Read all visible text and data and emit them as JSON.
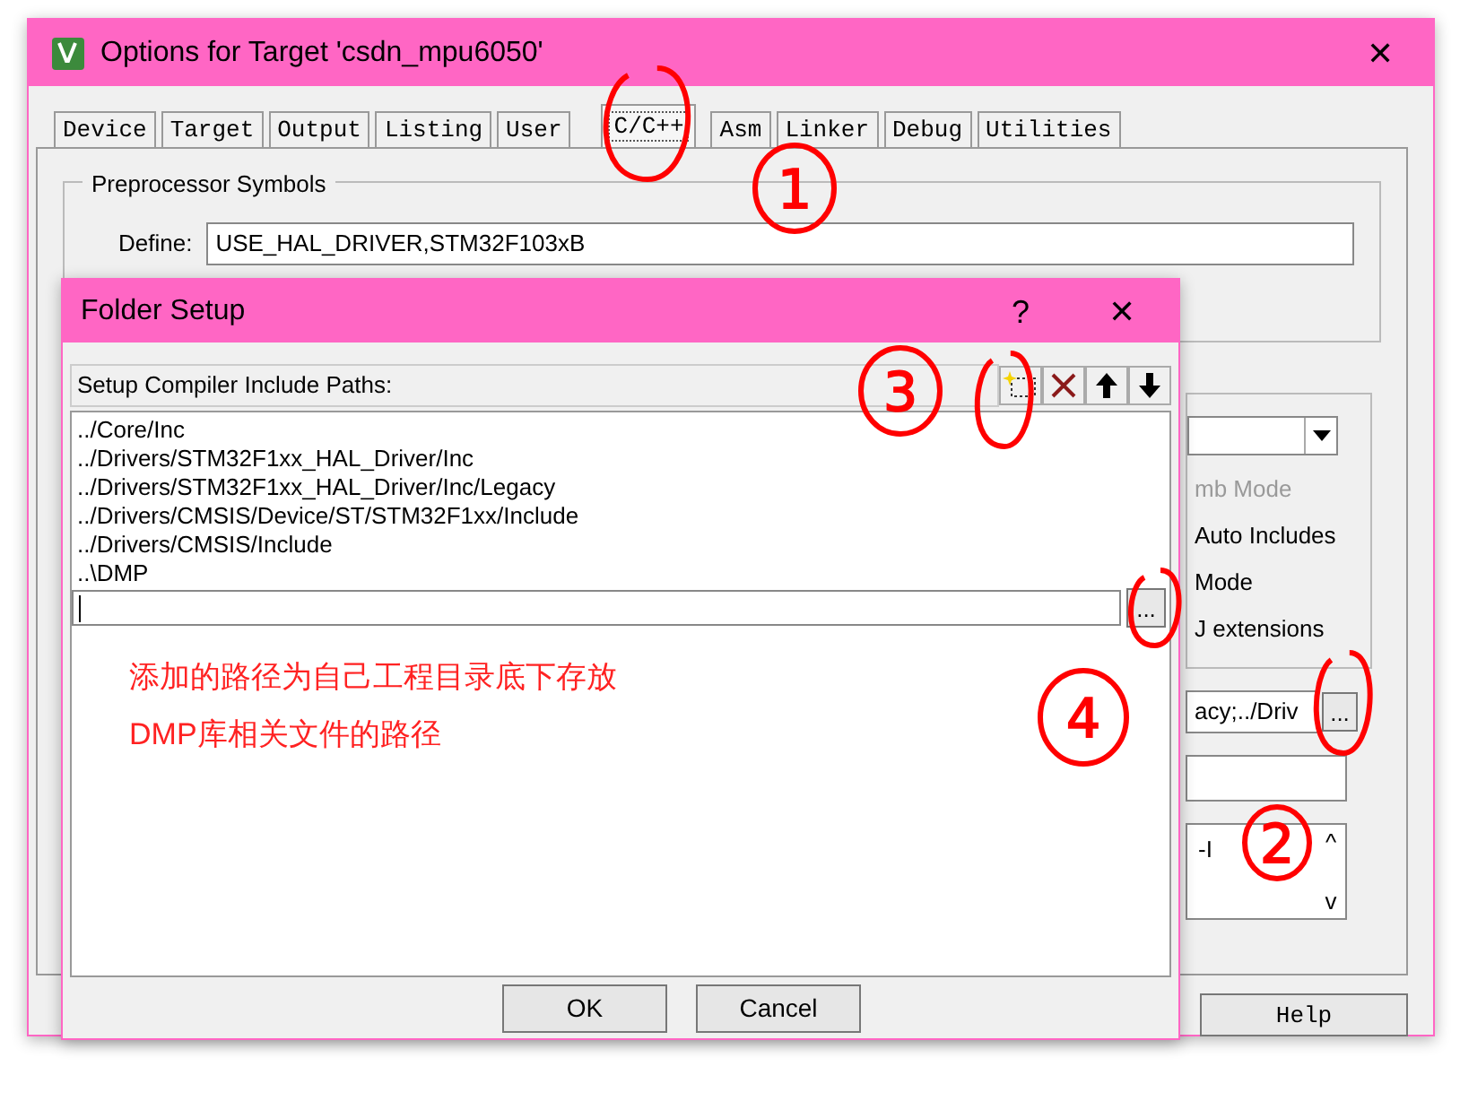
{
  "window": {
    "title": "Options for Target 'csdn_mpu6050'",
    "close": "✕"
  },
  "tabs": [
    {
      "label": "Device",
      "selected": false
    },
    {
      "label": "Target",
      "selected": false
    },
    {
      "label": "Output",
      "selected": false
    },
    {
      "label": "Listing",
      "selected": false
    },
    {
      "label": "User",
      "selected": false
    },
    {
      "label": "C/C++",
      "selected": true
    },
    {
      "label": "Asm",
      "selected": false
    },
    {
      "label": "Linker",
      "selected": false
    },
    {
      "label": "Debug",
      "selected": false
    },
    {
      "label": "Utilities",
      "selected": false
    }
  ],
  "preprocessor": {
    "title": "Preprocessor Symbols",
    "define_label": "Define:",
    "define_value": "USE_HAL_DRIVER,STM32F103xB"
  },
  "options": [
    {
      "label": "mb Mode",
      "disabled": true
    },
    {
      "label": "Auto Includes",
      "disabled": false
    },
    {
      "label": "Mode",
      "disabled": false
    },
    {
      "label": "J extensions",
      "disabled": false
    }
  ],
  "include_paths_field": {
    "value": "acy;../Driv",
    "browse": "..."
  },
  "misc_controls": {
    "value": "-I",
    "scroll_up": "^",
    "scroll_down": "v"
  },
  "help_button": "Help",
  "dialog": {
    "title": "Folder Setup",
    "help": "?",
    "close": "✕",
    "header": "Setup Compiler Include Paths:",
    "paths": [
      "../Core/Inc",
      "../Drivers/STM32F1xx_HAL_Driver/Inc",
      "../Drivers/STM32F1xx_HAL_Driver/Inc/Legacy",
      "../Drivers/CMSIS/Device/ST/STM32F1xx/Include",
      "../Drivers/CMSIS/Include",
      "..\\DMP"
    ],
    "browse": "...",
    "buttons": [
      "OK",
      "Cancel"
    ]
  },
  "note": [
    "添加的路径为自己工程目录底下存放",
    "DMP库相关文件的路径"
  ],
  "annotations": [
    {
      "text": "1"
    },
    {
      "text": "3"
    },
    {
      "text": "4"
    },
    {
      "text": "2"
    }
  ]
}
